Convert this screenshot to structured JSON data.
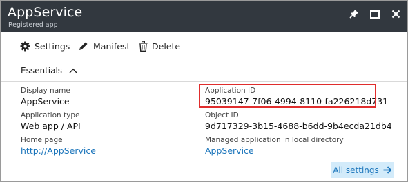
{
  "window": {
    "title": "AppService",
    "subtitle": "Registered app"
  },
  "commands": {
    "settings": "Settings",
    "manifest": "Manifest",
    "delete": "Delete"
  },
  "essentials": {
    "header": "Essentials",
    "display_name": {
      "label": "Display name",
      "value": "AppService"
    },
    "application_type": {
      "label": "Application type",
      "value": "Web app / API"
    },
    "home_page": {
      "label": "Home page",
      "value": "http://AppService"
    },
    "application_id": {
      "label": "Application ID",
      "value": "95039147-7f06-4994-8110-fa226218d731"
    },
    "object_id": {
      "label": "Object ID",
      "value": "9d717329-3b15-4688-b6dd-9b4ecda21db4"
    },
    "managed_app": {
      "label": "Managed application in local directory",
      "value": "AppService"
    }
  },
  "all_settings": "All settings",
  "icons": [
    "pin-icon",
    "maximize-icon",
    "close-icon",
    "gear-icon",
    "pencil-icon",
    "trash-icon",
    "chevron-up-icon",
    "arrow-right-icon"
  ],
  "colors": {
    "titlebar": "#32383f",
    "link": "#1b75bb",
    "highlight_border": "#e02d2d",
    "all_settings_bg": "#d3ebfa"
  }
}
